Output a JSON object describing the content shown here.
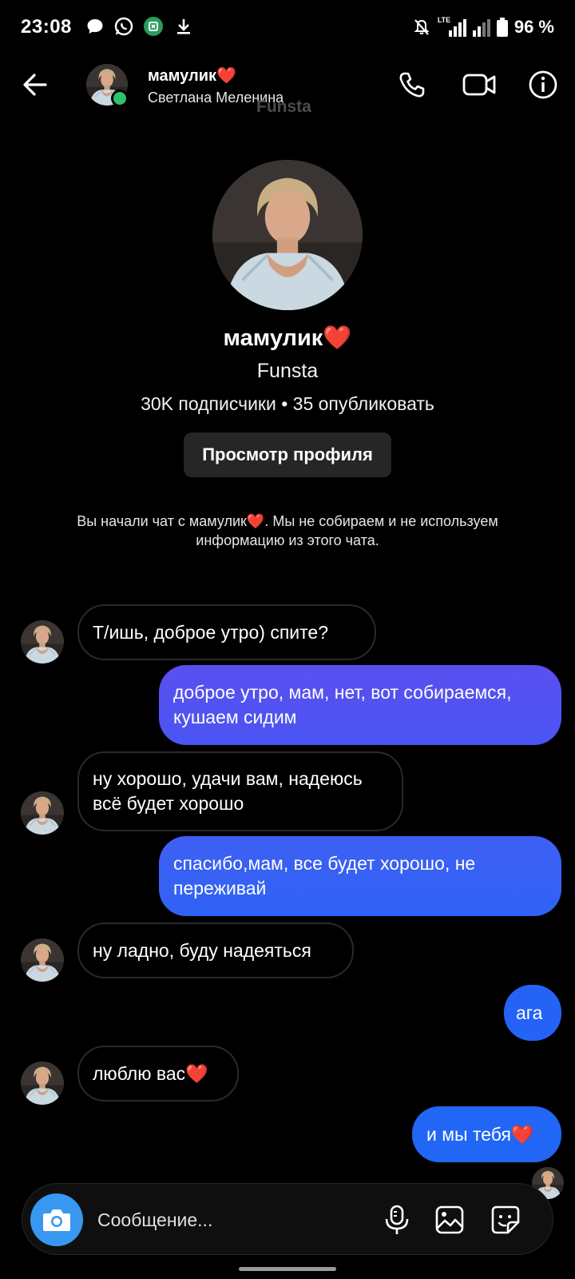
{
  "status_bar": {
    "time": "23:08",
    "network": "LTE",
    "battery": "96 %",
    "battery_percent": 96,
    "icons": [
      "chat-bubble-icon",
      "whatsapp-icon",
      "app-icon",
      "download-icon",
      "mute-icon",
      "signal-icon",
      "battery-icon"
    ]
  },
  "header": {
    "name": "мамулик❤️",
    "subtitle": "Светлана Меленина",
    "watermark": "Funsta",
    "online": true,
    "icons": [
      "back-arrow-icon",
      "phone-icon",
      "video-camera-icon",
      "info-icon"
    ]
  },
  "profile": {
    "name": "мамулик❤️",
    "app": "Funsta",
    "stats": "30K подписчики • 35 опубликовать",
    "view_profile_label": "Просмотр профиля"
  },
  "notice": "Вы начали чат с мамулик❤️. Мы не собираем и не используем информацию из этого чата.",
  "messages": [
    {
      "from": "them",
      "text": "Т/ишь, доброе утро) спите?"
    },
    {
      "from": "me",
      "text": "доброе утро, мам, нет, вот собираемся, кушаем сидим"
    },
    {
      "from": "them",
      "text": "ну хорошо, удачи вам, надеюсь всё будет хорошо"
    },
    {
      "from": "me",
      "text": "спасибо,мам, все будет хорошо, не переживай"
    },
    {
      "from": "them",
      "text": "ну ладно, буду надеяться"
    },
    {
      "from": "me",
      "text": "ага"
    },
    {
      "from": "them",
      "text": "люблю вас❤️"
    },
    {
      "from": "me",
      "text": "и мы тебя❤️"
    }
  ],
  "composer": {
    "placeholder": "Сообщение...",
    "icons": [
      "camera-icon",
      "microphone-icon",
      "gallery-icon",
      "sticker-icon"
    ]
  },
  "colors": {
    "background": "#000000",
    "accent_blue": "#3897f0",
    "bubble_top": "#5b4cf0",
    "bubble_bottom": "#1f63f5",
    "online_green": "#2dc26b"
  }
}
